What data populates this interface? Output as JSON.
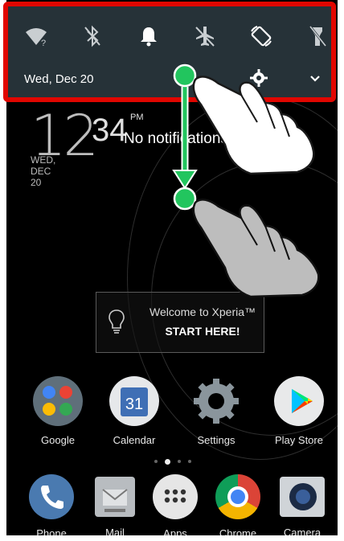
{
  "status_bar": {
    "quick_settings": [
      {
        "name": "wifi-icon"
      },
      {
        "name": "bluetooth-icon"
      },
      {
        "name": "bell-icon"
      },
      {
        "name": "airplane-mode-icon"
      },
      {
        "name": "auto-rotate-icon"
      },
      {
        "name": "flashlight-icon"
      }
    ],
    "date": "Wed, Dec 20"
  },
  "lockscreen": {
    "hour": "12",
    "minute": "34",
    "ampm": "PM",
    "date": "WED, DEC 20",
    "notification_text": "No notifications"
  },
  "welcome": {
    "line1": "Welcome to Xperia™",
    "line2": "START HERE!"
  },
  "home_apps": [
    {
      "label": "Google",
      "icon": "google-folder-icon"
    },
    {
      "label": "Calendar",
      "icon": "calendar-icon",
      "badge": "31"
    },
    {
      "label": "Settings",
      "icon": "settings-icon"
    },
    {
      "label": "Play Store",
      "icon": "play-store-icon"
    }
  ],
  "dock": [
    {
      "label": "Phone",
      "icon": "phone-icon"
    },
    {
      "label": "Mail",
      "icon": "mail-icon"
    },
    {
      "label": "Apps",
      "icon": "apps-icon"
    },
    {
      "label": "Chrome",
      "icon": "chrome-icon"
    },
    {
      "label": "Camera",
      "icon": "camera-icon"
    }
  ],
  "colors": {
    "highlight_border": "#e10600",
    "panel_bg": "#263238",
    "gesture_green": "#22c55e"
  }
}
